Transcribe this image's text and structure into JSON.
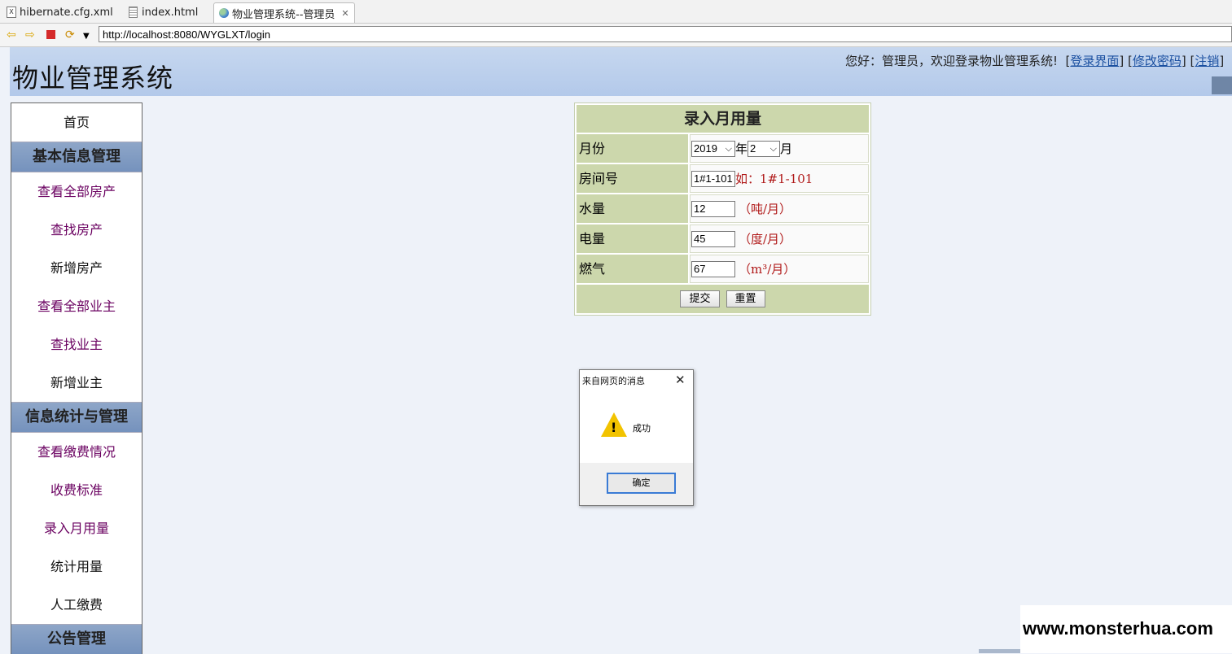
{
  "editor_tabs": [
    {
      "label": "hibernate.cfg.xml",
      "icon": "xml-file-icon"
    },
    {
      "label": "index.html",
      "icon": "html-file-icon"
    },
    {
      "label": "物业管理系统--管理员",
      "icon": "globe-icon",
      "active": true
    }
  ],
  "toolbar": {
    "url": "http://localhost:8080/WYGLXT/login"
  },
  "header": {
    "title": "物业管理系统",
    "greeting": "您好：管理员，欢迎登录物业管理系统!",
    "links": [
      "登录界面",
      "修改密码",
      "注销"
    ]
  },
  "sidebar": {
    "items": [
      {
        "type": "link",
        "label": "首页",
        "plain": true
      },
      {
        "type": "header",
        "label": "基本信息管理"
      },
      {
        "type": "link",
        "label": "查看全部房产"
      },
      {
        "type": "link",
        "label": "查找房产"
      },
      {
        "type": "link",
        "label": "新增房产",
        "plain": true
      },
      {
        "type": "link",
        "label": "查看全部业主"
      },
      {
        "type": "link",
        "label": "查找业主"
      },
      {
        "type": "link",
        "label": "新增业主",
        "plain": true
      },
      {
        "type": "header",
        "label": "信息统计与管理"
      },
      {
        "type": "link",
        "label": "查看缴费情况"
      },
      {
        "type": "link",
        "label": "收费标准"
      },
      {
        "type": "link",
        "label": "录入月用量"
      },
      {
        "type": "link",
        "label": "统计用量",
        "plain": true
      },
      {
        "type": "link",
        "label": "人工缴费",
        "plain": true
      },
      {
        "type": "header",
        "label": "公告管理"
      }
    ]
  },
  "form": {
    "title": "录入月用量",
    "month_label": "月份",
    "year_value": "2019",
    "year_suffix": "年",
    "month_value": "2",
    "month_suffix": "月",
    "room_label": "房间号",
    "room_value": "1#1-101",
    "room_hint": "如：1#1-101",
    "water_label": "水量",
    "water_value": "12",
    "water_unit": "（吨/月）",
    "power_label": "电量",
    "power_value": "45",
    "power_unit": "（度/月）",
    "gas_label": "燃气",
    "gas_value": "67",
    "gas_unit": "（m³/月）",
    "submit_label": "提交",
    "reset_label": "重置"
  },
  "dialog": {
    "title": "来自网页的消息",
    "message": "成功",
    "ok_label": "确定"
  },
  "watermark": "www.monsterhua.com"
}
